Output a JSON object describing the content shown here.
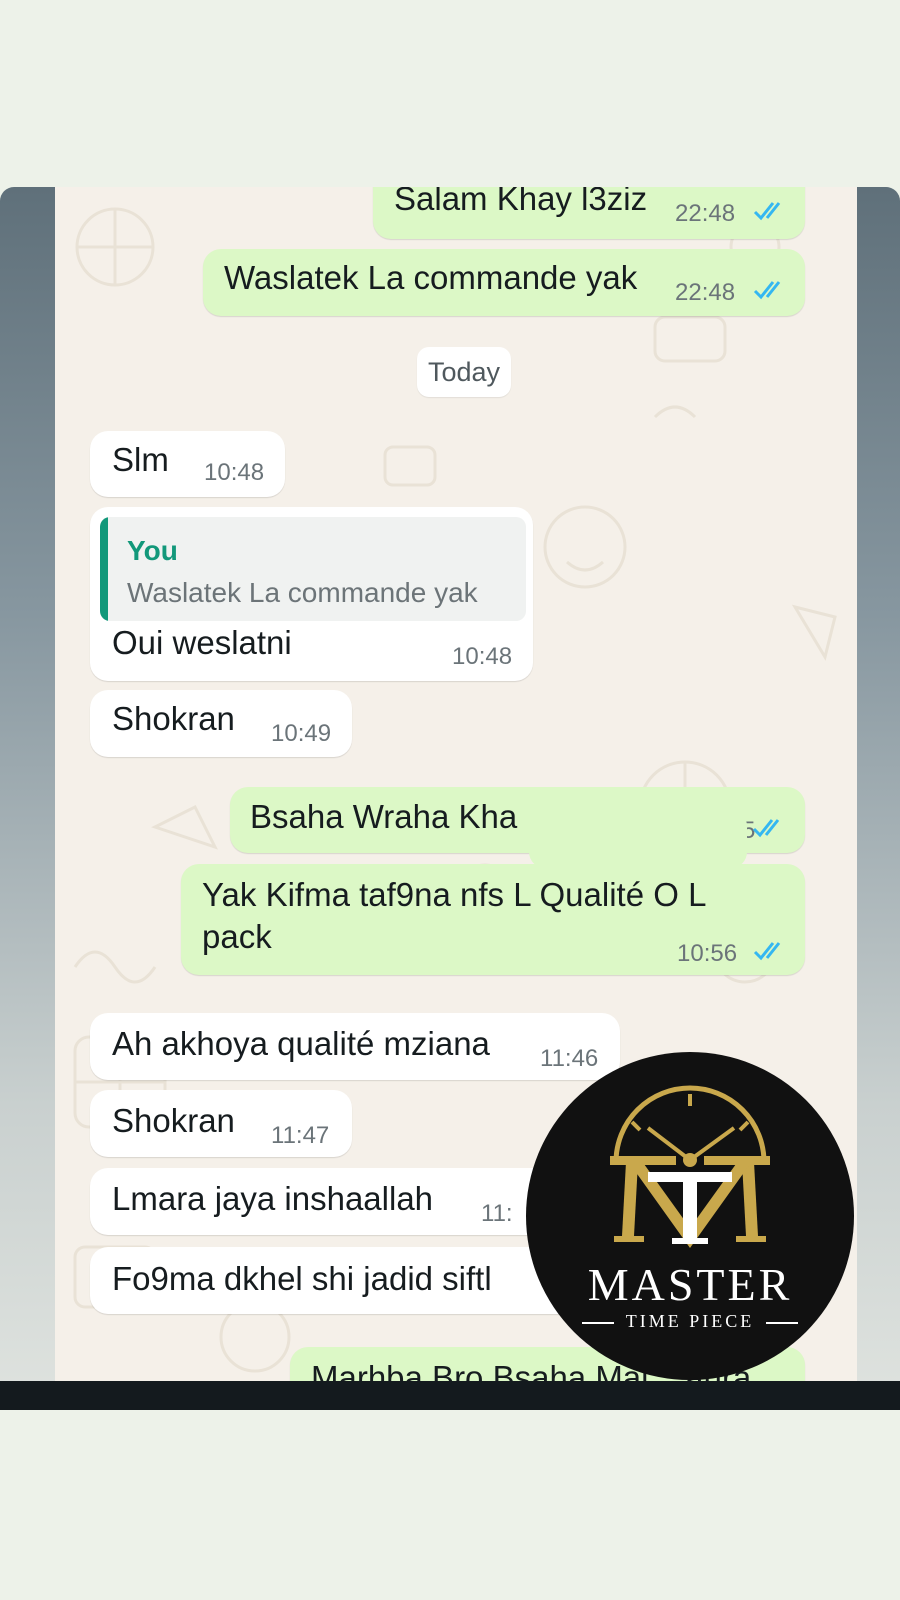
{
  "chat": {
    "date_divider": "Today",
    "messages": [
      {
        "direction": "outgoing",
        "text": "Salam Khay l3ziz",
        "time": "22:48",
        "status": "read"
      },
      {
        "direction": "outgoing",
        "text": "Waslatek La commande yak",
        "time": "22:48",
        "status": "read"
      },
      {
        "direction": "incoming",
        "text": "Slm",
        "time": "10:48"
      },
      {
        "direction": "incoming",
        "reply_to": {
          "author": "You",
          "text": "Waslatek La commande yak"
        },
        "text": "Oui weslatni",
        "time": "10:48"
      },
      {
        "direction": "incoming",
        "text": "Shokran",
        "time": "10:49"
      },
      {
        "direction": "outgoing",
        "text": "Bsaha Wraha Kha",
        "time": "5",
        "status": "read"
      },
      {
        "direction": "outgoing",
        "text_line1": "Yak Kifma taf9na nfs L Qualité O L",
        "text_line2": "pack",
        "time": "10:56",
        "status": "read"
      },
      {
        "direction": "incoming",
        "text": "Ah akhoya qualité mziana",
        "time": "11:46"
      },
      {
        "direction": "incoming",
        "text": "Shokran",
        "time": "11:47"
      },
      {
        "direction": "incoming",
        "text": "Lmara jaya inshaallah",
        "time": "11:"
      },
      {
        "direction": "incoming",
        "text": "Fo9ma dkhel shi jadid siftl"
      },
      {
        "direction": "outgoing",
        "text": "Marhba Bro Bsaha Mal... ahra"
      }
    ]
  },
  "logo": {
    "monogram": "MT",
    "brand_name": "MASTER",
    "brand_tagline": "TIME PIECE",
    "gold_color": "#c9a84c"
  },
  "colors": {
    "outgoing_bubble": "#dcf8c6",
    "incoming_bubble": "#ffffff",
    "chat_background": "#f5f0e9",
    "read_ticks": "#34b7f1",
    "quote_accent": "#12987a"
  },
  "icons": {
    "read_status": "double-check-icon",
    "logo_clock": "clock-icon"
  }
}
